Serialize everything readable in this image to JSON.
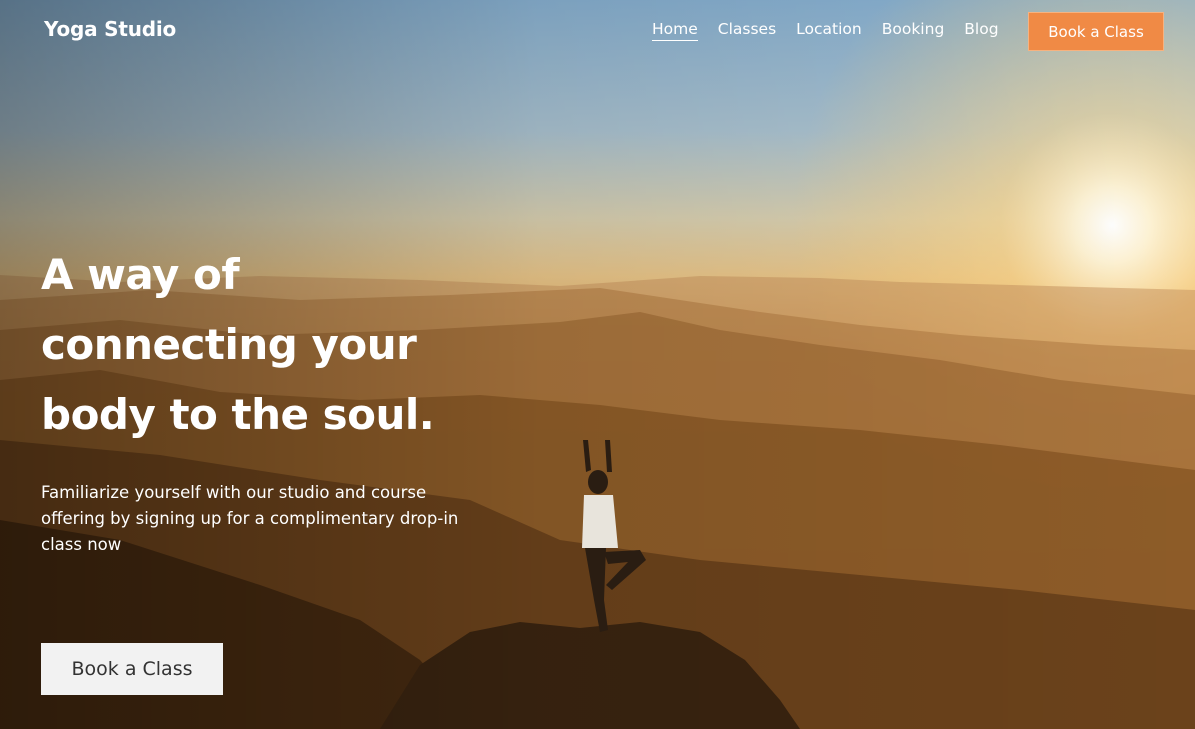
{
  "header": {
    "logo": "Yoga Studio",
    "nav": [
      {
        "label": "Home",
        "active": true
      },
      {
        "label": "Classes",
        "active": false
      },
      {
        "label": "Location",
        "active": false
      },
      {
        "label": "Booking",
        "active": false
      },
      {
        "label": "Blog",
        "active": false
      }
    ],
    "cta_label": "Book a Class"
  },
  "hero": {
    "title_lines": [
      "A way of",
      "connecting your",
      "body to the soul."
    ],
    "subtitle": "Familiarize yourself with our studio and course offering by signing up for a complimentary drop-in class now",
    "cta_label": "Book a Class",
    "background_image": "mountain-sunrise-yoga-photo"
  },
  "colors": {
    "accent": "#f08a45",
    "text": "#ffffff",
    "button_light": "#f2f2f2"
  }
}
